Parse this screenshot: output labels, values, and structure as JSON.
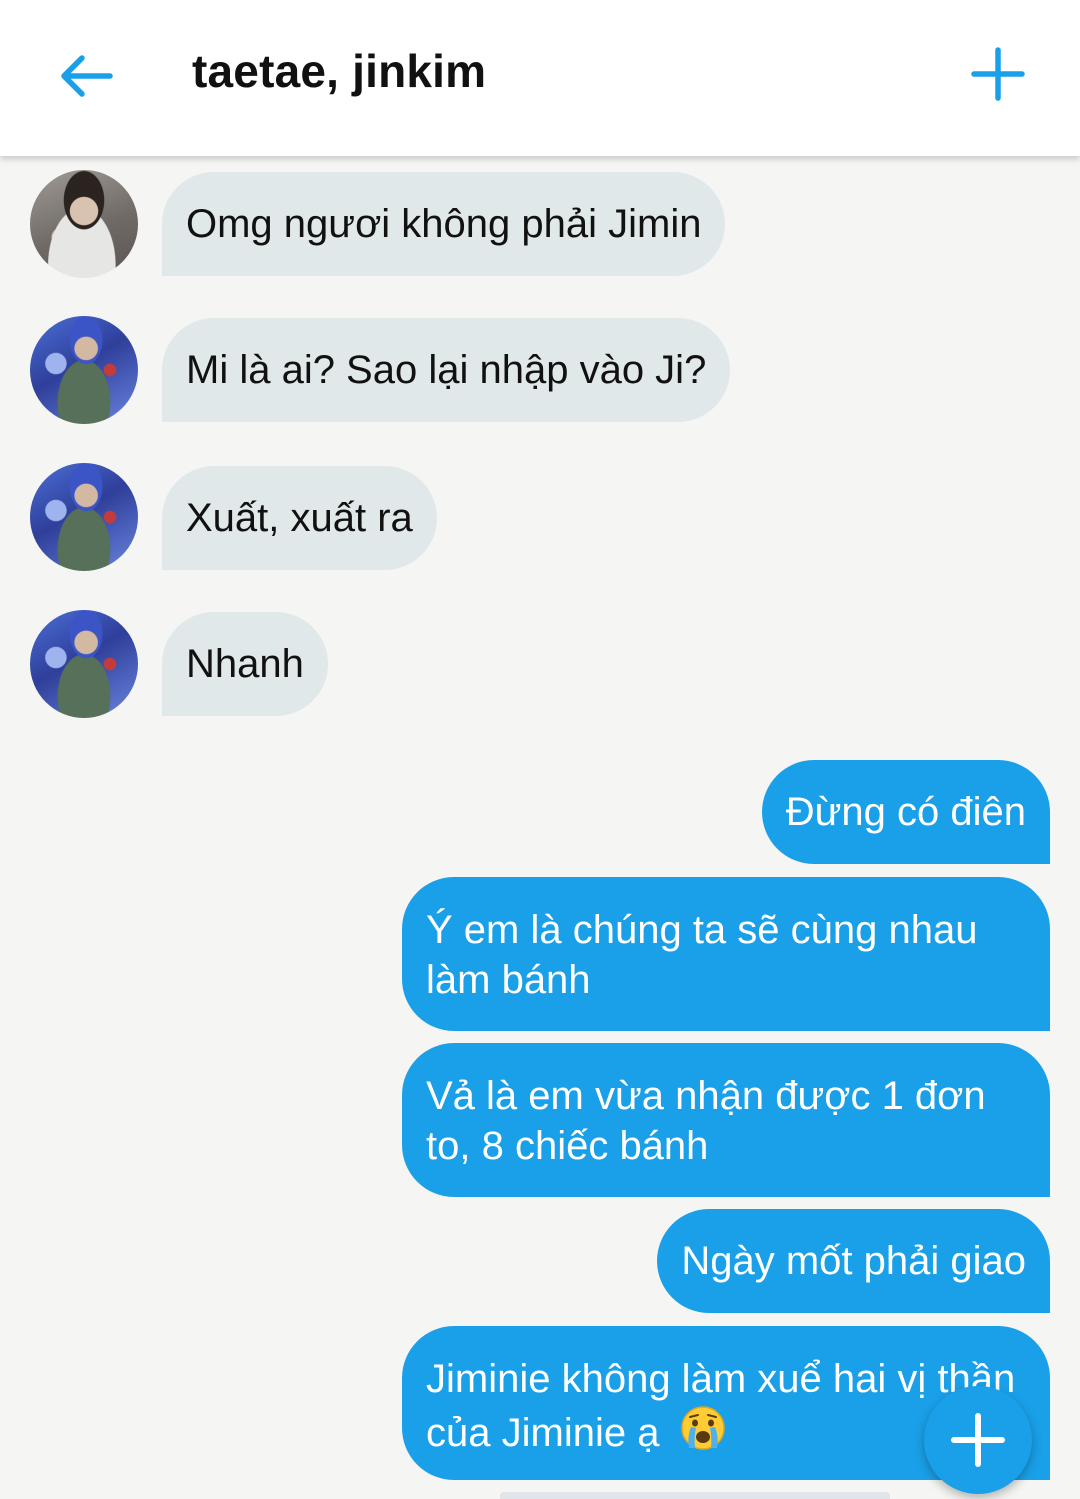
{
  "header": {
    "title": "taetae, jinkim",
    "back_icon": "arrow-left-icon",
    "add_icon": "plus-icon",
    "accent_color": "#1aa0e8"
  },
  "messages": [
    {
      "direction": "in",
      "avatar": "avatar-1",
      "text": "Omg ngươi không phải Jimin"
    },
    {
      "direction": "in",
      "avatar": "avatar-2",
      "text": "Mi là ai? Sao lại nhập vào Ji?"
    },
    {
      "direction": "in",
      "avatar": "avatar-2",
      "text": "Xuất, xuất ra"
    },
    {
      "direction": "in",
      "avatar": "avatar-2",
      "text": "Nhanh"
    },
    {
      "direction": "out",
      "text": "Đừng có điên"
    },
    {
      "direction": "out",
      "text": "Ý em là chúng ta sẽ cùng nhau làm bánh"
    },
    {
      "direction": "out",
      "text": "Vả là em vừa nhận được 1 đơn to, 8 chiếc bánh"
    },
    {
      "direction": "out",
      "text": "Ngày mốt phải giao"
    },
    {
      "direction": "out",
      "text": "Jiminie không làm xuể hai vị thần của Jiminie ạ",
      "emoji": "crying-face-icon"
    }
  ],
  "fab": {
    "icon": "plus-icon"
  },
  "colors": {
    "incoming_bubble": "#e1e8ea",
    "outgoing_bubble": "#1aa0e8",
    "background": "#f5f5f3"
  }
}
